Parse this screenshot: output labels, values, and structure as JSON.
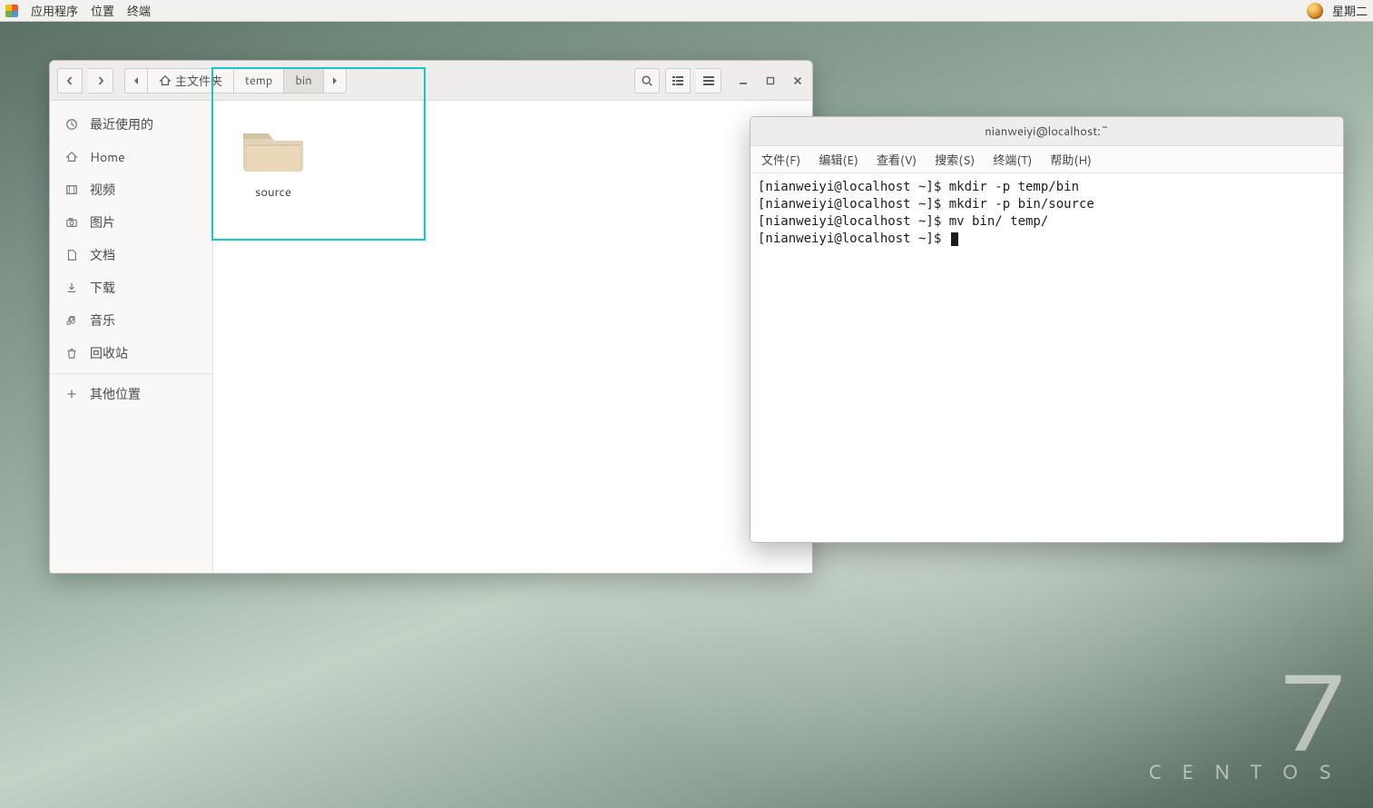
{
  "panel": {
    "menu": {
      "apps": "应用程序",
      "places": "位置",
      "terminal": "终端"
    },
    "right": {
      "day": "星期二"
    }
  },
  "brand": {
    "seven": "7",
    "word": "CENTOS"
  },
  "filemgr": {
    "sidebar": {
      "recent": "最近使用的",
      "home": "Home",
      "videos": "视频",
      "pictures": "图片",
      "documents": "文档",
      "downloads": "下载",
      "music": "音乐",
      "trash": "回收站",
      "other": "其他位置"
    },
    "path": {
      "root": "主文件夹",
      "seg1": "temp",
      "seg2": "bin"
    },
    "items": [
      {
        "name": "source"
      }
    ]
  },
  "terminal": {
    "title": "nianweiyi@localhost:~",
    "menu": {
      "file": "文件(F)",
      "edit": "编辑(E)",
      "view": "查看(V)",
      "search": "搜索(S)",
      "terminal": "终端(T)",
      "help": "帮助(H)"
    },
    "lines": [
      "[nianweiyi@localhost ~]$ mkdir -p temp/bin",
      "[nianweiyi@localhost ~]$ mkdir -p bin/source",
      "[nianweiyi@localhost ~]$ mv bin/ temp/",
      "[nianweiyi@localhost ~]$ "
    ]
  }
}
